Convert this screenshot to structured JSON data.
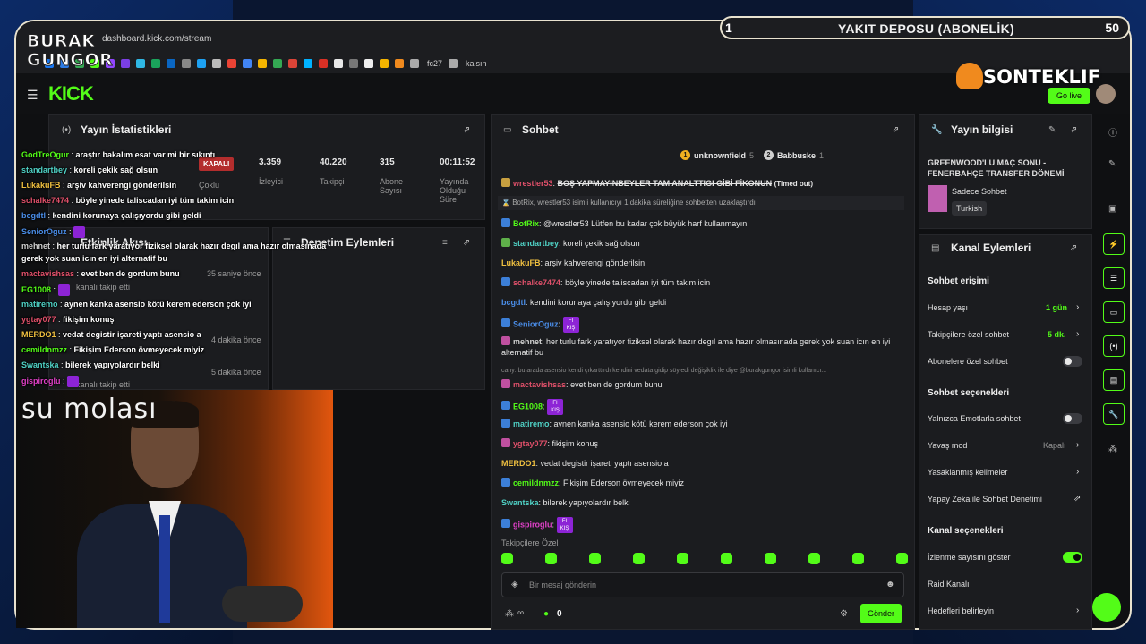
{
  "browser": {
    "url": "dashboard.kick.com/stream",
    "bookmarks": [
      "fc27",
      "kalsın"
    ]
  },
  "header": {
    "logo": "KICK",
    "button_label": "Go live"
  },
  "stats": {
    "title": "Yayın İstatistikleri",
    "status": "KAPALI",
    "status_label": "Çoklu",
    "viewers": "3.359",
    "viewers_label": "İzleyici",
    "followers": "40.220",
    "followers_label": "Takipçi",
    "subs": "315",
    "subs_label": "Abone Sayısı",
    "duration": "00:11:52",
    "duration_label": "Yayında Olduğu Süre"
  },
  "activity": {
    "title": "Etkinlik Akışı",
    "times": [
      "35 saniye önce",
      "4 dakika önce",
      "5 dakika önce"
    ],
    "events": [
      "kanalı takip etti",
      "kanalı takip etti"
    ]
  },
  "moderation": {
    "title": "Denetim Eylemleri"
  },
  "chat": {
    "title": "Sohbet",
    "leaderboard": [
      {
        "rank": "1",
        "name": "unknownfield",
        "count": "5"
      },
      {
        "rank": "2",
        "name": "Babbuske",
        "count": "1"
      }
    ],
    "timeout_line": {
      "user": "wrestler53",
      "text": "BOŞ YAPMAYINBEYLER TAM ANALTTIGI GİBİ FİKONUN",
      "tag": "(Timed out)"
    },
    "system": "BotRix, wrestler53 isimli kullanıcıyı 1 dakika süreliğine sohbetten uzaklaştırdı",
    "reply_preview": "cany: bu arada asensio kendi çıkarttırdı kendini vedata gidip söyledi değişiklik ile diye @burakgungor isimli kullanıcı...",
    "messages": [
      {
        "user": "BotRix",
        "color": "#53fc18",
        "text": "@wrestler53 Lütfen bu kadar çok büyük harf kullanmayın."
      },
      {
        "user": "standartbey",
        "color": "#4fd1c5",
        "text": "koreli çekik sağ olsun"
      },
      {
        "user": "LukakuFB",
        "color": "#f0c040",
        "text": "arşiv kahverengi gönderilsin"
      },
      {
        "user": "schalke7474",
        "color": "#e0506a",
        "text": "böyle yinede taliscadan iyi tüm takim icin"
      },
      {
        "user": "bcgdtl",
        "color": "#4a8de8",
        "text": "kendini korunaya çalışıyordu gibi geldi"
      },
      {
        "user": "SeniorOguz",
        "color": "#4a8de8",
        "text": ""
      },
      {
        "user": "mehnet",
        "color": "#cfcfcf",
        "text": "her turlu fark yaratıyor fiziksel olarak hazır degıl ama hazır olmasınada gerek yok suan icın en iyi alternatif bu"
      },
      {
        "user": "mactavishsas",
        "color": "#e0506a",
        "text": "evet ben de gordum bunu"
      },
      {
        "user": "EG1008",
        "color": "#53fc18",
        "text": ""
      },
      {
        "user": "matiremo",
        "color": "#4fd1c5",
        "text": "aynen kanka asensio kötü kerem ederson çok iyi"
      },
      {
        "user": "ygtay077",
        "color": "#e0506a",
        "text": "fikişim konuş"
      },
      {
        "user": "MERDO1",
        "color": "#f0c040",
        "text": "vedat degistir işareti yaptı asensio a"
      },
      {
        "user": "cemildnmzz",
        "color": "#53fc18",
        "text": "Fikişim Ederson övmeyecek miyiz"
      },
      {
        "user": "Swantska",
        "color": "#4fd1c5",
        "text": "bilerek yapıyolardır belki"
      },
      {
        "user": "gispiroglu",
        "color": "#e040c8",
        "text": ""
      }
    ],
    "kis_label_top": "FI",
    "kis_label_bottom": "KIŞ",
    "followers_only": "Takipçilere Özel",
    "input_placeholder": "Bir mesaj gönderin",
    "send_label": "Gönder",
    "viewer_sym": "∞",
    "kick_count": "0"
  },
  "stream_info": {
    "title": "Yayın bilgisi",
    "stream_title": "GREENWOOD'LU MAÇ SONU - FENERBAHÇE TRANSFER DÖNEMİ",
    "category": "Sadece Sohbet",
    "tag": "Turkish"
  },
  "channel": {
    "title": "Kanal Eylemleri",
    "chat_access": "Sohbet erişimi",
    "account_age": "Hesap yaşı",
    "account_age_val": "1 gün",
    "followers_only": "Takipçilere özel sohbet",
    "followers_only_val": "5 dk.",
    "subs_only": "Abonelere özel sohbet",
    "chat_options": "Sohbet seçenekleri",
    "emotes_only": "Yalnızca Emotlarla sohbet",
    "slow_mode": "Yavaş mod",
    "slow_mode_val": "Kapalı",
    "banned_words": "Yasaklanmış kelimeler",
    "ai_mod": "Yapay Zeka ile Sohbet Denetimi",
    "channel_options": "Kanal seçenekleri",
    "show_viewers": "İzlenme sayısını göster",
    "raid": "Raid Kanalı",
    "goals": "Hedefleri belirleyin"
  },
  "overlay": {
    "brand_line1": "BURAK",
    "brand_line2": "GUNGOR",
    "banner_num": "1",
    "banner_title": "YAKIT DEPOSU (ABONELİK)",
    "banner_count": "50",
    "sonteklif": "SONTEKLIF",
    "su_molasi": "su molası",
    "chat": [
      {
        "user": "GodTreOgur",
        "color": "#53fc18",
        "text": "araştır bakalım esat var mi bir sıkıntı"
      },
      {
        "user": "standartbey",
        "color": "#4fd1c5",
        "text": "koreli çekik sağ olsun"
      },
      {
        "user": "LukakuFB",
        "color": "#f0c040",
        "text": "arşiv kahverengi gönderilsin"
      },
      {
        "user": "schalke7474",
        "color": "#e0506a",
        "text": "böyle yinede taliscadan iyi tüm takim icin"
      },
      {
        "user": "bcgdtl",
        "color": "#4a8de8",
        "text": "kendini korunaya çalışıyordu gibi geldi"
      },
      {
        "user": "SeniorOguz",
        "color": "#4a8de8",
        "text": ""
      },
      {
        "user": "mehnet",
        "color": "#cfcfcf",
        "text": "her turlu fark yaratıyor fiziksel olarak hazır degıl ama hazır olmasınada"
      },
      {
        "user": "",
        "color": "#ffffff",
        "text": "gerek yok suan icın en iyi alternatif bu"
      },
      {
        "user": "mactavishsas",
        "color": "#e0506a",
        "text": "evet ben de gordum bunu"
      },
      {
        "user": "EG1008",
        "color": "#53fc18",
        "text": ""
      },
      {
        "user": "matiremo",
        "color": "#4fd1c5",
        "text": "aynen kanka asensio kötü kerem ederson çok iyi"
      },
      {
        "user": "ygtay077",
        "color": "#e0506a",
        "text": "fikişim konuş"
      },
      {
        "user": "MERDO1",
        "color": "#f0c040",
        "text": "vedat degistir işareti yaptı asensio a"
      },
      {
        "user": "cemildnmzz",
        "color": "#53fc18",
        "text": "Fikişim Ederson övmeyecek miyiz"
      },
      {
        "user": "Swantska",
        "color": "#4fd1c5",
        "text": "bilerek yapıyolardır belki"
      },
      {
        "user": "gispiroglu",
        "color": "#e040c8",
        "text": ""
      }
    ]
  }
}
